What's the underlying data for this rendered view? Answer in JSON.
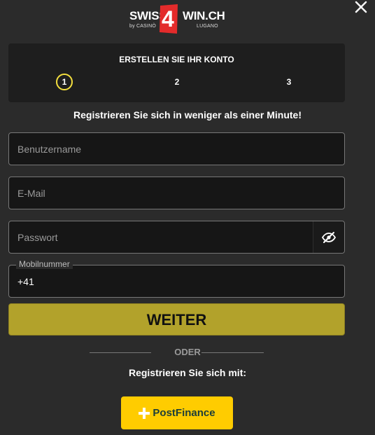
{
  "logo": {
    "word_left": "SWISS",
    "word_right": "WIN.CH",
    "digit": "4",
    "by": "by CASINÒ",
    "city": "LUGANO"
  },
  "steps": {
    "title": "ERSTELLEN SIE IHR KONTO",
    "items": [
      "1",
      "2",
      "3"
    ]
  },
  "subtitle": "Registrieren Sie sich in weniger als einer Minute!",
  "form": {
    "username_placeholder": "Benutzername",
    "email_placeholder": "E-Mail",
    "password_placeholder": "Passwort",
    "mobile_label": "Mobilnummer",
    "mobile_value": "+41"
  },
  "submit_label": "WEITER",
  "divider": "ODER",
  "register_with": "Registrieren Sie sich mit:",
  "postfinance_label": "PostFinance",
  "colors": {
    "accent": "#b2a22b",
    "step_active": "#f4df3e",
    "postfinance": "#ffcc00",
    "logo_red": "#e32b2b"
  }
}
